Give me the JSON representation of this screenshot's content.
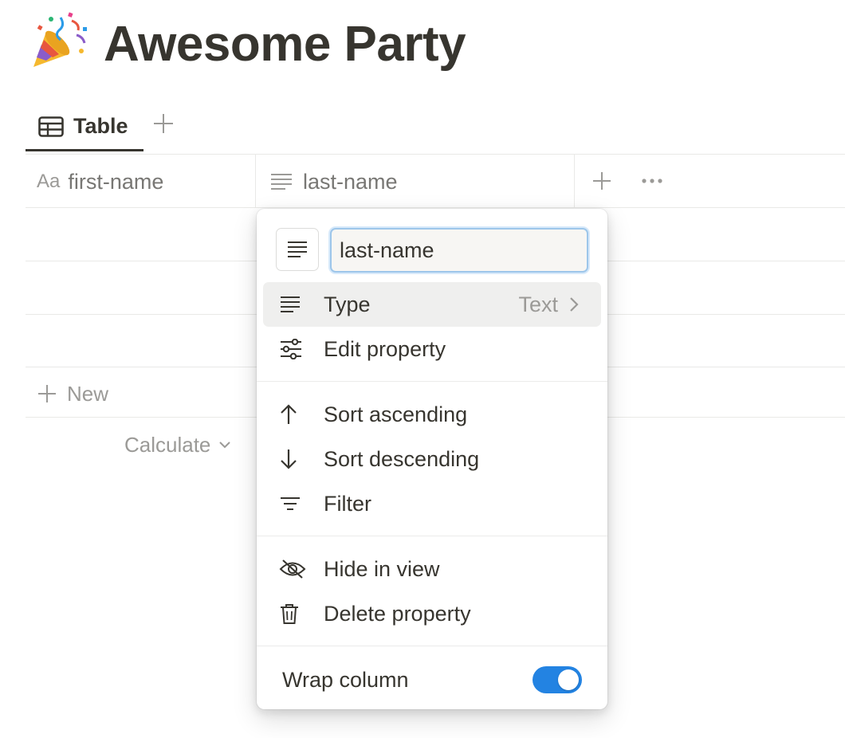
{
  "page": {
    "title": "Awesome Party",
    "emoji": "party-popper"
  },
  "view_tabs": {
    "active_tab_label": "Table",
    "add_view_icon": "plus-icon"
  },
  "table": {
    "columns": [
      {
        "icon_text": "Aa",
        "label": "first-name"
      },
      {
        "icon": "text-lines-icon",
        "label": "last-name"
      }
    ],
    "new_row_label": "New",
    "calculate_label": "Calculate"
  },
  "property_menu": {
    "name_value": "last-name",
    "items": [
      {
        "label": "Type",
        "value": "Text",
        "icon": "text-lines-icon"
      },
      {
        "label": "Edit property",
        "icon": "sliders-icon"
      },
      {
        "label": "Sort ascending",
        "icon": "arrow-up-icon"
      },
      {
        "label": "Sort descending",
        "icon": "arrow-down-icon"
      },
      {
        "label": "Filter",
        "icon": "filter-icon"
      },
      {
        "label": "Hide in view",
        "icon": "eye-off-icon"
      },
      {
        "label": "Delete property",
        "icon": "trash-icon"
      }
    ],
    "wrap_column": {
      "label": "Wrap column",
      "enabled": true
    }
  },
  "colors": {
    "toggle_on": "#2383e2",
    "text": "#37352f",
    "muted": "#9b9a97",
    "focus_ring": "#9dc6ea"
  }
}
